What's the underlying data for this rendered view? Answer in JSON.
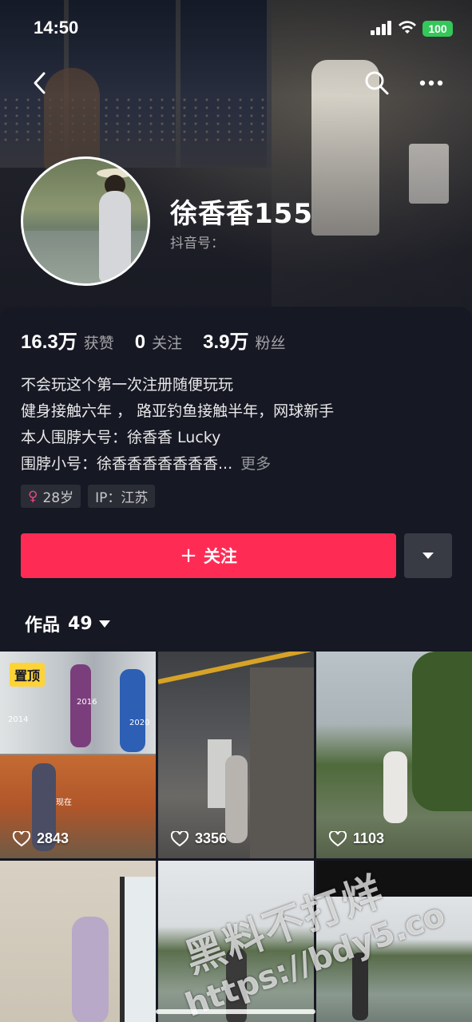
{
  "status_bar": {
    "time": "14:50",
    "battery": "100"
  },
  "profile": {
    "name": "徐香香155",
    "douyin_id_label": "抖音号：",
    "stats": [
      {
        "num": "16.3万",
        "label": "获赞"
      },
      {
        "num": "0",
        "label": "关注"
      },
      {
        "num": "3.9万",
        "label": "粉丝"
      }
    ],
    "bio": [
      "不会玩这个第一次注册随便玩玩",
      "健身接触六年 ， 路亚钓鱼接触半年，网球新手",
      "本人围脖大号：徐香香 Lucky",
      "围脖小号：徐香香香香香香香..."
    ],
    "bio_more": "更多",
    "tags": {
      "age": "28岁",
      "ip": "IP：江苏"
    }
  },
  "actions": {
    "follow_label": "关注"
  },
  "works": {
    "label": "作品",
    "count": "49"
  },
  "videos": [
    {
      "likes": "2843",
      "pinned": "置顶",
      "years": [
        "2016",
        "2020",
        "2014",
        "现在"
      ]
    },
    {
      "likes": "3356"
    },
    {
      "likes": "1103"
    },
    {
      "likes": ""
    },
    {
      "likes": ""
    },
    {
      "likes": ""
    }
  ],
  "watermark": {
    "line1": "黑料不打烊",
    "line2": "https://bdy5.co"
  }
}
